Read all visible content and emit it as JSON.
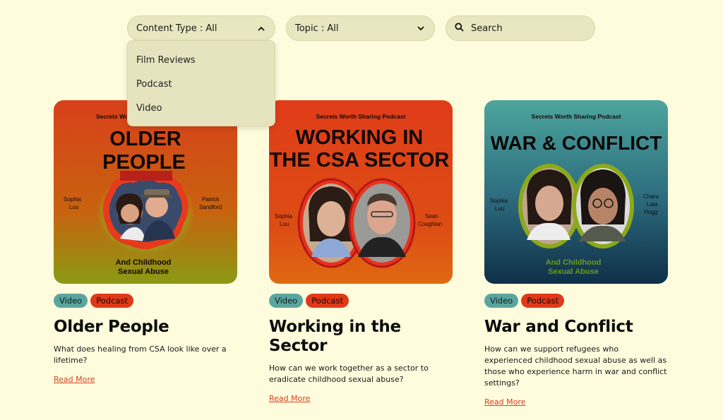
{
  "filters": {
    "content_type_label": "Content Type : All",
    "topic_label": "Topic : All",
    "search_placeholder": "Search"
  },
  "dropdown": {
    "items": [
      "Film Reviews",
      "Podcast",
      "Video"
    ]
  },
  "cards": [
    {
      "brand": "Secrets Worth Sharing Podcast",
      "headline_line1": "OLDER",
      "headline_line2": "PEOPLE",
      "guest_left": [
        "Sophia",
        "Luu"
      ],
      "guest_right": [
        "Patrick",
        "Sandford"
      ],
      "footer_line1": "And Childhood",
      "footer_line2": "Sexual Abuse",
      "tags": [
        "Video",
        "Podcast"
      ],
      "title": "Older People",
      "description": "What does healing from CSA look like over a lifetime?",
      "read_more": "Read More"
    },
    {
      "brand": "Secrets Worth Sharing Podcast",
      "headline_line1": "WORKING IN",
      "headline_line2": "THE CSA SECTOR",
      "guest_left": [
        "Sophia",
        "Luu"
      ],
      "guest_right": [
        "Sean",
        "Coughlan"
      ],
      "tags": [
        "Video",
        "Podcast"
      ],
      "title": "Working in the Sector",
      "description": "How can we work together as a sector to eradicate childhood sexual abuse?",
      "read_more": "Read More"
    },
    {
      "brand": "Secrets Worth Sharing Podcast",
      "headline_line1": "WAR & CONFLICT",
      "guest_left": [
        "Sophia",
        "Luu"
      ],
      "guest_right": [
        "Charu",
        "Lata",
        "Hogg"
      ],
      "footer_line1": "And Childhood",
      "footer_line2": "Sexual Abuse",
      "tags": [
        "Video",
        "Podcast"
      ],
      "title": "War and Conflict",
      "description": "How can we support refugees who experienced childhood sexual abuse as well as those who experience harm in war and conflict settings?",
      "read_more": "Read More"
    }
  ],
  "colors": {
    "page_bg": "#fefcdc",
    "filter_bg": "#e9e7c0",
    "tag_video": "#5aa59f",
    "tag_podcast": "#e0391a",
    "link": "#d8401f"
  }
}
